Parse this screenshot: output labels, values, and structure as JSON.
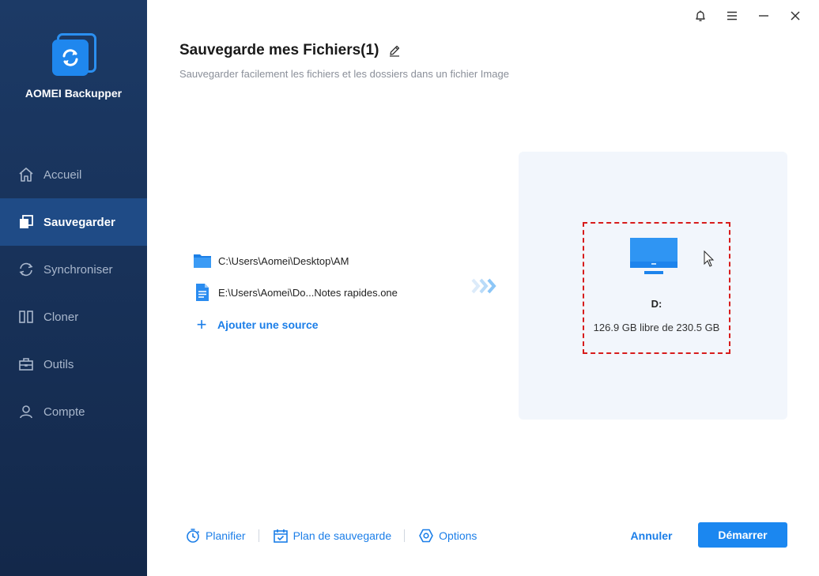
{
  "app": {
    "name": "AOMEI Backupper"
  },
  "sidebar": {
    "items": [
      {
        "label": "Accueil",
        "icon": "home-icon",
        "active": false
      },
      {
        "label": "Sauvegarder",
        "icon": "backup-icon",
        "active": true
      },
      {
        "label": "Synchroniser",
        "icon": "sync-icon",
        "active": false
      },
      {
        "label": "Cloner",
        "icon": "clone-icon",
        "active": false
      },
      {
        "label": "Outils",
        "icon": "toolbox-icon",
        "active": false
      },
      {
        "label": "Compte",
        "icon": "user-icon",
        "active": false
      }
    ]
  },
  "header": {
    "title": "Sauvegarde mes Fichiers(1)",
    "subtitle": "Sauvegarder facilement les fichiers et les dossiers dans un fichier Image"
  },
  "sources": {
    "items": [
      {
        "path": "C:\\Users\\Aomei\\Desktop\\AM",
        "icon": "folder-icon"
      },
      {
        "path": "E:\\Users\\Aomei\\Do...Notes rapides.one",
        "icon": "file-icon"
      }
    ],
    "add_label": "Ajouter une source"
  },
  "destination": {
    "drive": "D:",
    "space": "126.9 GB libre de 230.5 GB"
  },
  "bottom": {
    "schedule_label": "Planifier",
    "plan_label": "Plan de sauvegarde",
    "options_label": "Options",
    "cancel_label": "Annuler",
    "start_label": "Démarrer"
  },
  "colors": {
    "sidebar_bg": "#1c3a66",
    "sidebar_active": "#1f4b86",
    "accent": "#1b87f0",
    "dest_panel_bg": "#f2f6fc",
    "highlight_border": "#d71c1c"
  }
}
